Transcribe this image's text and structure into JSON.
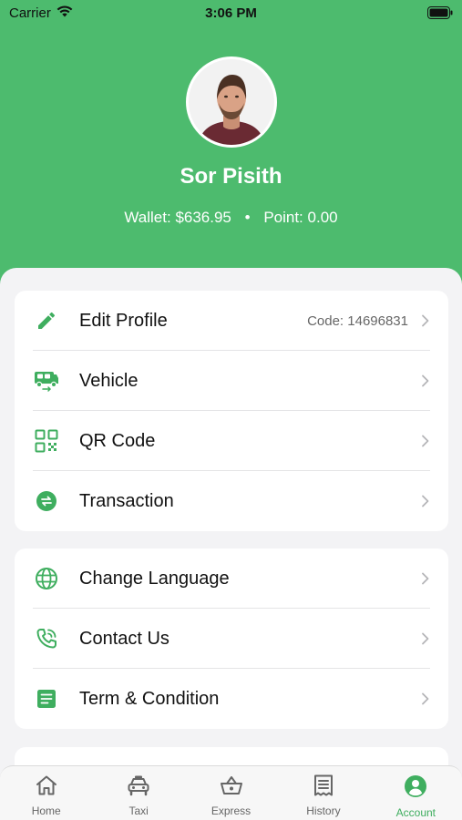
{
  "status_bar": {
    "carrier": "Carrier",
    "time": "3:06 PM"
  },
  "profile": {
    "name": "Sor Pisith",
    "wallet_label": "Wallet:",
    "wallet_value": "$636.95",
    "separator": "•",
    "point_label": "Point:",
    "point_value": "0.00"
  },
  "menu_group_1": [
    {
      "label": "Edit Profile",
      "meta": "Code: 14696831",
      "icon": "pencil-icon"
    },
    {
      "label": "Vehicle",
      "icon": "vehicle-icon"
    },
    {
      "label": "QR Code",
      "icon": "qr-code-icon"
    },
    {
      "label": "Transaction",
      "icon": "transfer-icon"
    }
  ],
  "menu_group_2": [
    {
      "label": "Change Language",
      "icon": "globe-icon"
    },
    {
      "label": "Contact Us",
      "icon": "phone-icon"
    },
    {
      "label": "Term & Condition",
      "icon": "document-icon"
    }
  ],
  "tabs": [
    {
      "label": "Home",
      "icon": "home-icon",
      "active": false
    },
    {
      "label": "Taxi",
      "icon": "taxi-icon",
      "active": false
    },
    {
      "label": "Express",
      "icon": "basket-icon",
      "active": false
    },
    {
      "label": "History",
      "icon": "receipt-icon",
      "active": false
    },
    {
      "label": "Account",
      "icon": "account-icon",
      "active": true
    }
  ],
  "colors": {
    "brand_green": "#4dbb6e",
    "tab_active": "#3fae5f",
    "background": "#f3f3f5"
  }
}
